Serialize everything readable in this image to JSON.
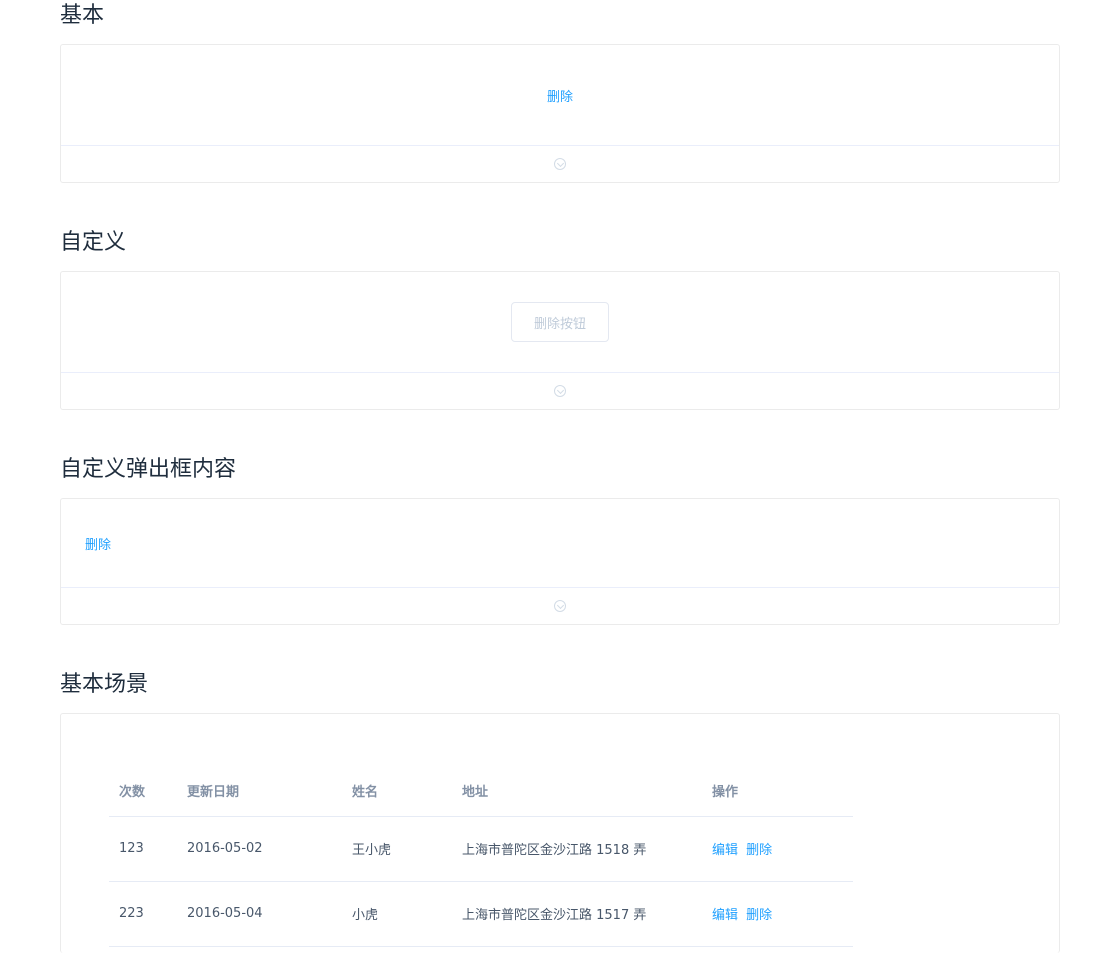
{
  "sections": {
    "basic": {
      "title": "基本",
      "delete_label": "删除"
    },
    "custom": {
      "title": "自定义",
      "delete_button_label": "删除按钮"
    },
    "custom_popup": {
      "title": "自定义弹出框内容",
      "delete_label": "删除"
    },
    "scene": {
      "title": "基本场景",
      "table": {
        "headers": [
          "次数",
          "更新日期",
          "姓名",
          "地址",
          "操作"
        ],
        "rows": [
          {
            "count": "123",
            "date": "2016-05-02",
            "name": "王小虎",
            "address": "上海市普陀区金沙江路 1518 弄",
            "edit": "编辑",
            "delete": "删除"
          },
          {
            "count": "223",
            "date": "2016-05-04",
            "name": "小虎",
            "address": "上海市普陀区金沙江路 1517 弄",
            "edit": "编辑",
            "delete": "删除"
          }
        ]
      }
    }
  },
  "colors": {
    "link": "#20a0ff",
    "border": "#ebebeb"
  },
  "icons": {
    "expand": "chevron-down-circle-icon"
  }
}
